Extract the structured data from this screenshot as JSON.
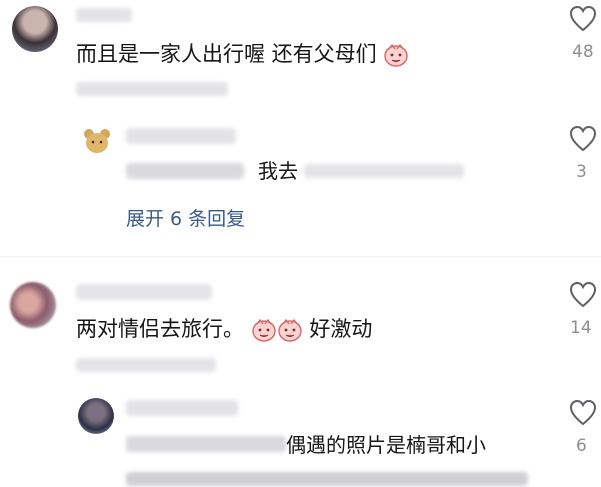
{
  "comments": [
    {
      "text": "而且是一家人出行喔 还有父母们",
      "likes": "48",
      "reply": {
        "text_suffix": "我去",
        "likes": "3"
      },
      "expand_label": "展开 6 条回复"
    },
    {
      "text_before": "两对情侣去旅行。",
      "text_after": "好激动",
      "likes": "14",
      "reply": {
        "text_part": "偶遇的照片是楠哥和小",
        "likes": "6"
      }
    }
  ],
  "icons": {
    "like": "heart-outline-icon",
    "emoji": "peach-face-emoji-icon"
  },
  "colors": {
    "link": "#3a5a8a",
    "meta": "#8e8e93"
  }
}
